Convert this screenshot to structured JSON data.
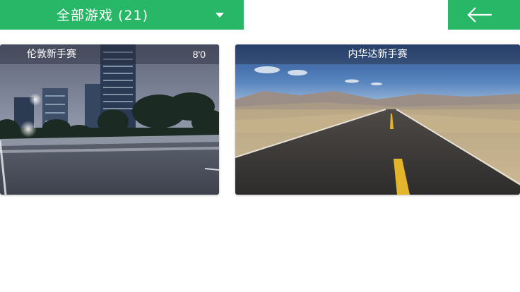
{
  "header": {
    "filter_label": "全部游戏 (21)",
    "back_icon": "arrow-left-icon",
    "dropdown_icon": "caret-down-icon",
    "accent_color": "#27b767"
  },
  "games": [
    {
      "title": "伦敦新手赛",
      "count": "8'0"
    },
    {
      "title": "内华达新手赛",
      "count": ""
    }
  ]
}
